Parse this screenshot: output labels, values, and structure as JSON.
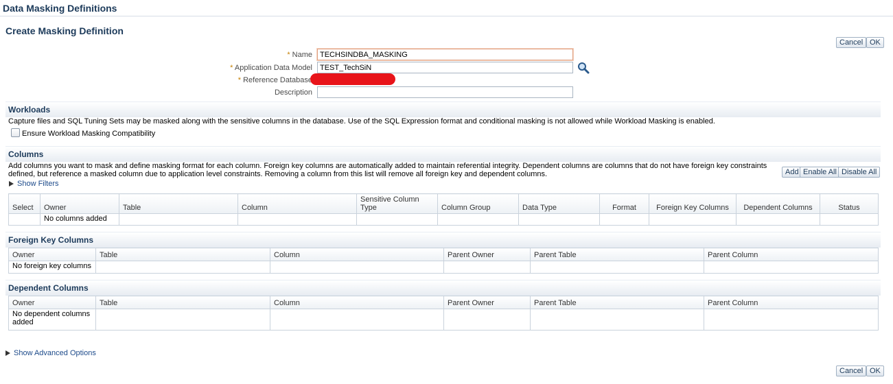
{
  "page": {
    "title": "Data Masking Definitions",
    "subtitle": "Create Masking Definition"
  },
  "buttons": {
    "cancel": "Cancel",
    "ok": "OK",
    "add": "Add",
    "enable_all": "Enable All",
    "disable_all": "Disable All"
  },
  "form": {
    "required_mark": "*",
    "name_label": "Name",
    "name_value": "TECHSINDBA_MASKING",
    "adm_label": "Application Data Model",
    "adm_value": "TEST_TechSiN",
    "refdb_label": "Reference Database",
    "desc_label": "Description",
    "desc_value": "",
    "search_icon": "magnifier-icon"
  },
  "workloads": {
    "title": "Workloads",
    "text": "Capture files and SQL Tuning Sets may be masked along with the sensitive columns in the database. Use of the SQL Expression format and conditional masking is not allowed while Workload Masking is enabled.",
    "checkbox_label": "Ensure Workload Masking Compatibility",
    "checked": false
  },
  "columns": {
    "title": "Columns",
    "text_line1": "Add columns you want to mask and define masking format for each column. Foreign key columns are automatically added to maintain referential integrity. Dependent columns are columns that do not have foreign key constraints",
    "text_line2": "defined, but reference a masked column due to application level constraints. Removing a column from this list will remove all foreign key and dependent columns.",
    "show_filters": "Show Filters",
    "headers": [
      "Select",
      "Owner",
      "Table",
      "Column",
      "Sensitive Column Type",
      "Column Group",
      "Data Type",
      "Format",
      "Foreign Key Columns",
      "Dependent Columns",
      "Status"
    ],
    "empty_text": "No columns added"
  },
  "foreign_keys": {
    "title": "Foreign Key Columns",
    "headers": [
      "Owner",
      "Table",
      "Column",
      "Parent Owner",
      "Parent Table",
      "Parent Column"
    ],
    "empty_text": "No foreign key columns"
  },
  "dependent": {
    "title": "Dependent Columns",
    "headers": [
      "Owner",
      "Table",
      "Column",
      "Parent Owner",
      "Parent Table",
      "Parent Column"
    ],
    "empty_text": "No dependent columns added"
  },
  "advanced": {
    "label": "Show Advanced Options"
  }
}
